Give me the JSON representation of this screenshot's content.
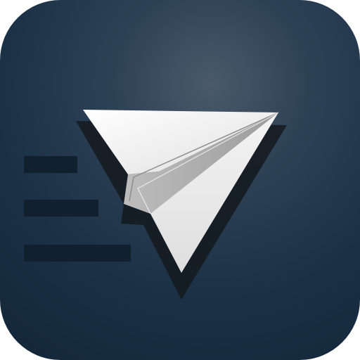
{
  "app_icon": {
    "icon": "paper-plane-icon",
    "speed_lines_icon": "speed-lines-icon",
    "colors": {
      "background_dark": "#132638",
      "background_light": "#4a5a6a",
      "plane": "#f2f2f2",
      "plane_shadow": "#141a20",
      "speed_lines": "#10202e"
    }
  }
}
